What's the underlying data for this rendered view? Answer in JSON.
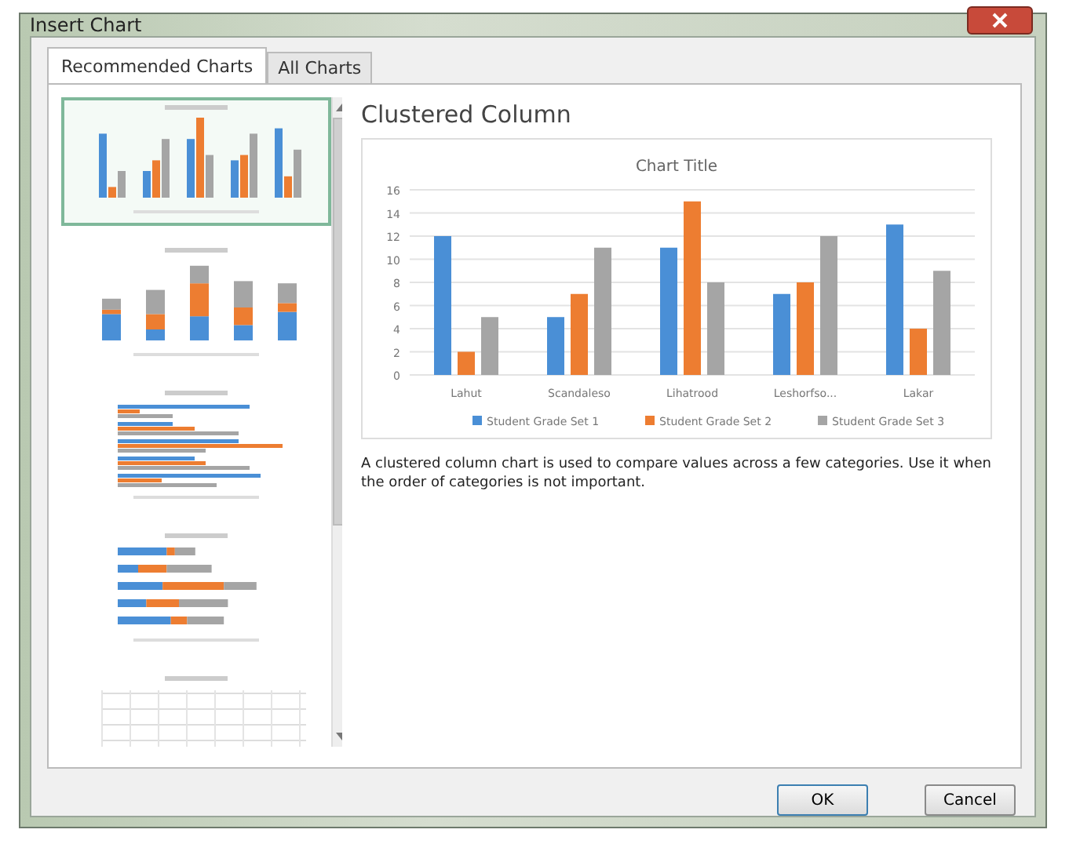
{
  "window": {
    "title": "Insert Chart"
  },
  "tabs": [
    {
      "label": "Recommended Charts",
      "selected": true
    },
    {
      "label": "All Charts",
      "selected": false
    }
  ],
  "thumbnails": [
    {
      "kind": "column",
      "selected": true
    },
    {
      "kind": "stacked",
      "selected": false
    },
    {
      "kind": "bar",
      "selected": false
    },
    {
      "kind": "stackedbar",
      "selected": false
    },
    {
      "kind": "grid",
      "selected": false
    }
  ],
  "preview": {
    "heading": "Clustered Column",
    "chart_data": {
      "type": "bar",
      "title": "Chart Title",
      "categories": [
        "Lahut",
        "Scandaleso",
        "Lihatrood",
        "Leshorfso...",
        "Lakar"
      ],
      "series": [
        {
          "name": "Student Grade Set 1",
          "color": "#4a8fd6",
          "values": [
            12,
            5,
            11,
            7,
            13
          ]
        },
        {
          "name": "Student Grade Set 2",
          "color": "#ed7d31",
          "values": [
            2,
            7,
            15,
            8,
            4
          ]
        },
        {
          "name": "Student Grade Set 3",
          "color": "#a5a5a5",
          "values": [
            5,
            11,
            8,
            12,
            9
          ]
        }
      ],
      "ylim": [
        0,
        16
      ],
      "grid": true,
      "legend": "bottom",
      "yticks": [
        0,
        2,
        4,
        6,
        8,
        10,
        12,
        14,
        16
      ]
    },
    "description": "A clustered column chart is used to compare values across a few categories. Use it when the order of categories is not important."
  },
  "buttons": [
    "OK",
    "Cancel"
  ]
}
